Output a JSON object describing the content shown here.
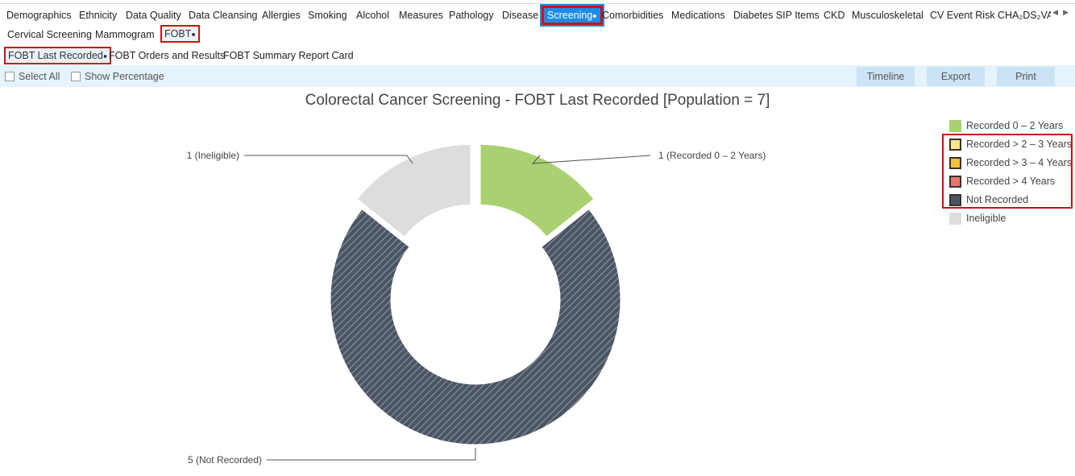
{
  "top_tabs": [
    {
      "label": "Demographics"
    },
    {
      "label": "Ethnicity"
    },
    {
      "label": "Data Quality"
    },
    {
      "label": "Data Cleansing"
    },
    {
      "label": "Allergies"
    },
    {
      "label": "Smoking"
    },
    {
      "label": "Alcohol"
    },
    {
      "label": "Measures"
    },
    {
      "label": "Pathology"
    },
    {
      "label": "Disease"
    },
    {
      "label": "Screening",
      "active": true
    },
    {
      "label": "Comorbidities"
    },
    {
      "label": "Medications"
    },
    {
      "label": "Diabetes SIP Items"
    },
    {
      "label": "CKD"
    },
    {
      "label": "Musculoskeletal"
    },
    {
      "label": "CV Event Risk"
    },
    {
      "label": "CHA₂DS₂VA"
    }
  ],
  "sub_tabs": [
    {
      "label": "Cervical Screening"
    },
    {
      "label": "Mammogram"
    },
    {
      "label": "FOBT",
      "active": true
    }
  ],
  "report_tabs": [
    {
      "label": "FOBT Last Recorded",
      "active": true
    },
    {
      "label": "FOBT Orders and Results"
    },
    {
      "label": "FOBT Summary Report Card"
    }
  ],
  "toolbar": {
    "select_all": "Select All",
    "show_percentage": "Show Percentage",
    "timeline": "Timeline",
    "export": "Export",
    "print": "Print"
  },
  "chart_data": {
    "type": "pie",
    "title": "Colorectal Cancer Screening - FOBT Last Recorded [Population = 7]",
    "donut": true,
    "slices": [
      {
        "label": "Recorded 0 – 2 Years",
        "value": 1,
        "color": "#a9d171",
        "data_label": "1 (Recorded 0 – 2 Years)"
      },
      {
        "label": "Not Recorded",
        "value": 5,
        "color": "#4b5563",
        "data_label": "5 (Not Recorded)"
      },
      {
        "label": "Ineligible",
        "value": 1,
        "color": "#dddddd",
        "data_label": "1 (Ineligible)"
      }
    ],
    "legend": [
      {
        "label": "Recorded 0 – 2 Years",
        "color": "#a9d171"
      },
      {
        "label": "Recorded > 2 – 3 Years",
        "color": "#fde58a"
      },
      {
        "label": "Recorded > 3 – 4 Years",
        "color": "#f5c43a"
      },
      {
        "label": "Recorded > 4 Years",
        "color": "#e8776b"
      },
      {
        "label": "Not Recorded",
        "color": "#4b5563"
      },
      {
        "label": "Ineligible",
        "color": "#dddddd"
      }
    ],
    "legend_position": "top-right"
  }
}
